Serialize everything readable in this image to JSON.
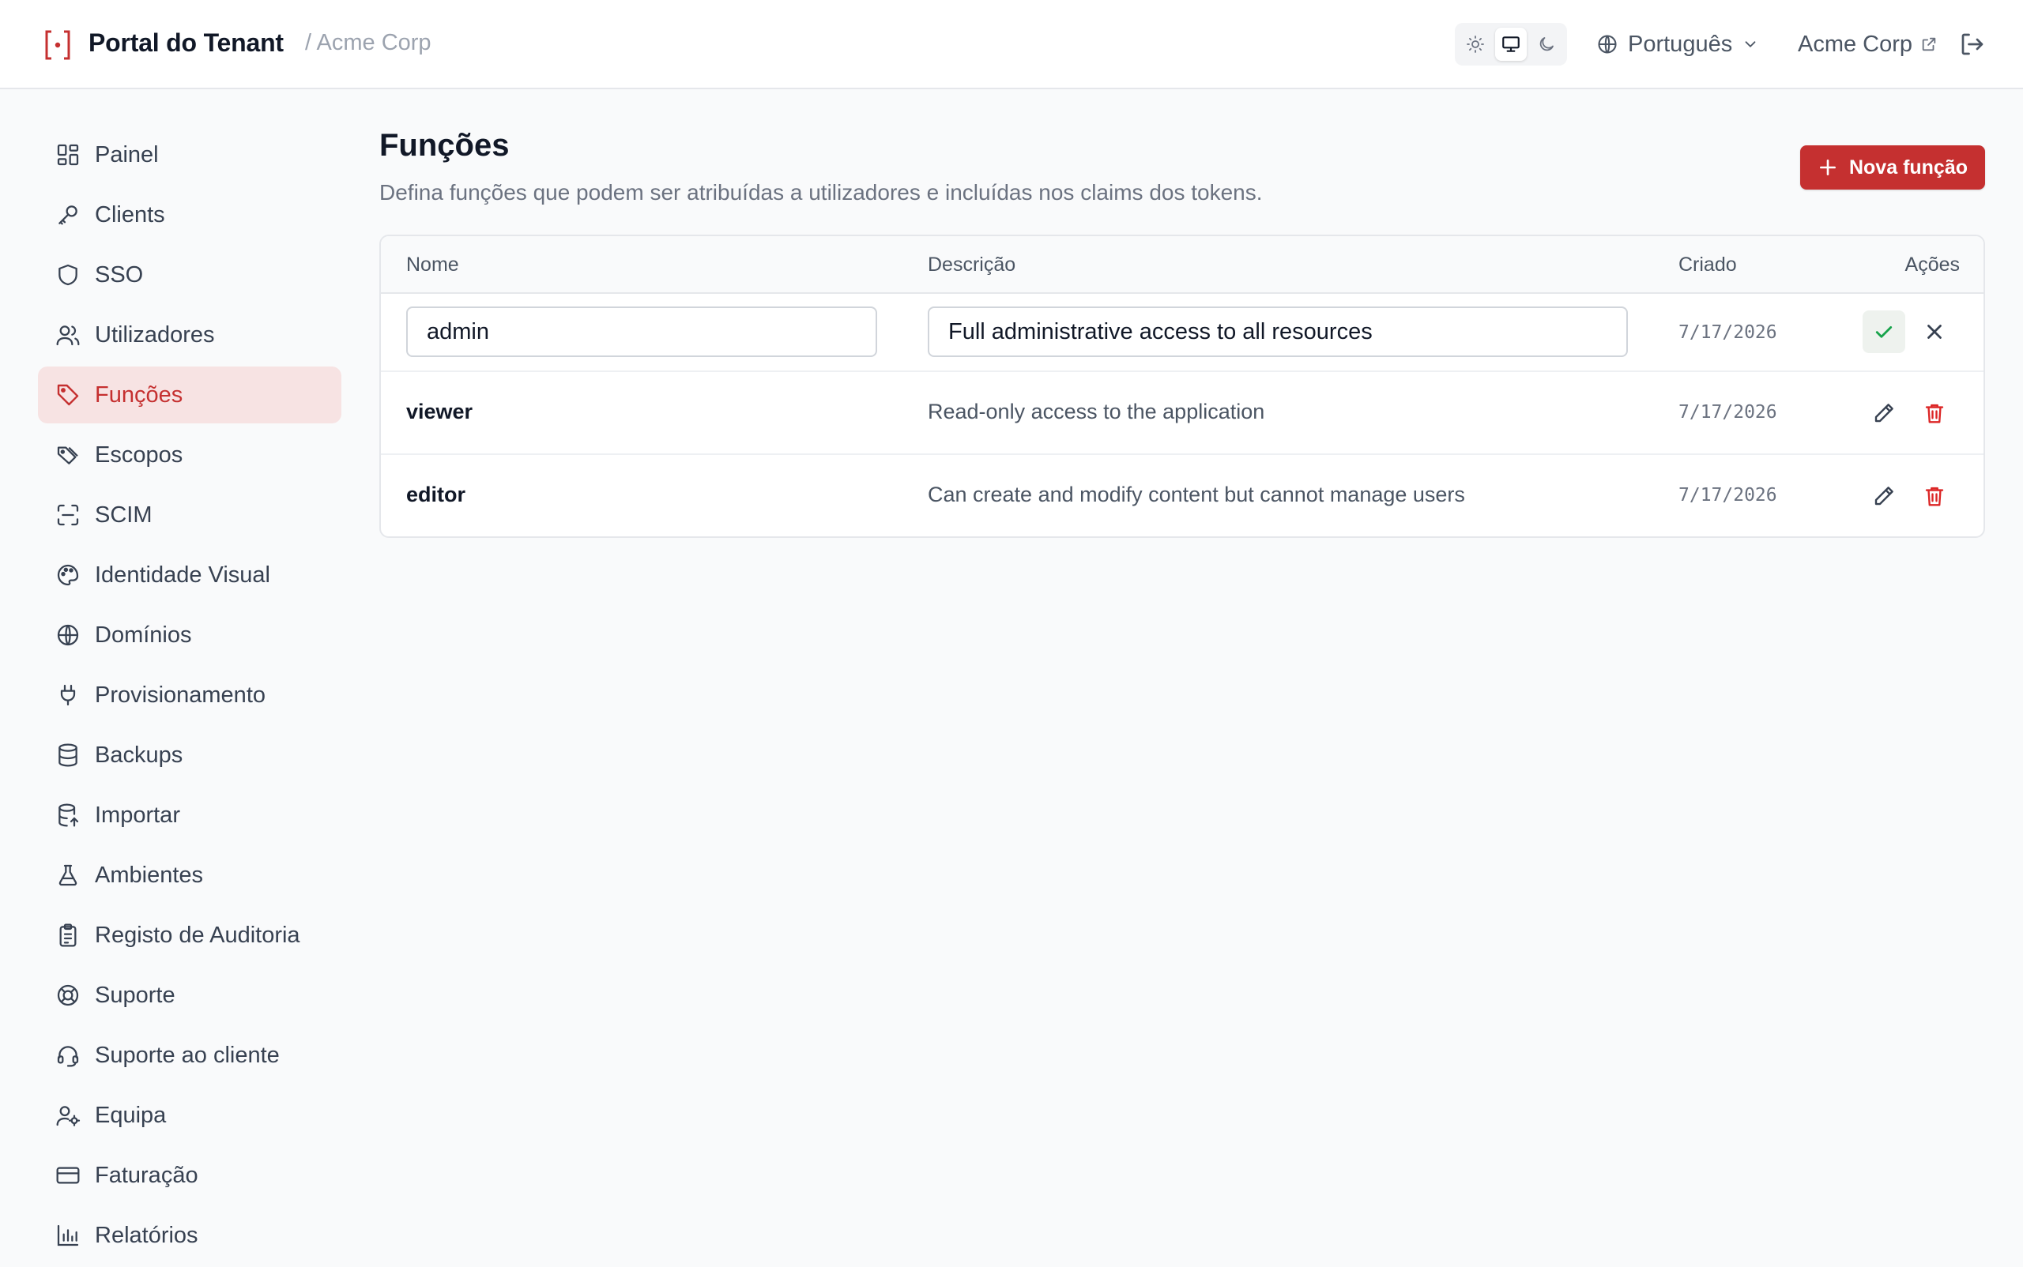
{
  "header": {
    "app_title": "Portal do Tenant",
    "tenant_crumb": "/ Acme Corp",
    "language": "Português",
    "tenant_link": "Acme Corp",
    "theme_modes": [
      "light",
      "system",
      "dark"
    ],
    "theme_selected": "system"
  },
  "sidebar": {
    "items": [
      {
        "label": "Painel",
        "icon": "dashboard-icon"
      },
      {
        "label": "Clients",
        "icon": "key-icon"
      },
      {
        "label": "SSO",
        "icon": "shield-icon"
      },
      {
        "label": "Utilizadores",
        "icon": "users-icon"
      },
      {
        "label": "Funções",
        "icon": "tag-icon",
        "active": true
      },
      {
        "label": "Escopos",
        "icon": "tags-icon"
      },
      {
        "label": "SCIM",
        "icon": "scan-icon"
      },
      {
        "label": "Identidade Visual",
        "icon": "palette-icon"
      },
      {
        "label": "Domínios",
        "icon": "globe-icon"
      },
      {
        "label": "Provisionamento",
        "icon": "plug-icon"
      },
      {
        "label": "Backups",
        "icon": "database-icon"
      },
      {
        "label": "Importar",
        "icon": "database-import-icon"
      },
      {
        "label": "Ambientes",
        "icon": "flask-icon"
      },
      {
        "label": "Registo de Auditoria",
        "icon": "clipboard-icon"
      },
      {
        "label": "Suporte",
        "icon": "lifebuoy-icon"
      },
      {
        "label": "Suporte ao cliente",
        "icon": "headset-icon"
      },
      {
        "label": "Equipa",
        "icon": "user-cog-icon"
      },
      {
        "label": "Faturação",
        "icon": "credit-card-icon"
      },
      {
        "label": "Relatórios",
        "icon": "bar-chart-icon"
      }
    ]
  },
  "main": {
    "title": "Funções",
    "description": "Defina funções que podem ser atribuídas a utilizadores e incluídas nos claims dos tokens.",
    "new_button": "Nova função",
    "table": {
      "columns": {
        "name": "Nome",
        "description": "Descrição",
        "created": "Criado",
        "actions": "Ações"
      },
      "editing_row": {
        "name": "admin",
        "description": "Full administrative access to all resources",
        "created": "7/17/2026"
      },
      "rows": [
        {
          "name": "viewer",
          "description": "Read-only access to the application",
          "created": "7/17/2026"
        },
        {
          "name": "editor",
          "description": "Can create and modify content but cannot manage users",
          "created": "7/17/2026"
        }
      ]
    }
  },
  "colors": {
    "accent": "#c53030",
    "active_nav_bg": "#f7e3e3",
    "confirm_green": "#16a34a"
  }
}
